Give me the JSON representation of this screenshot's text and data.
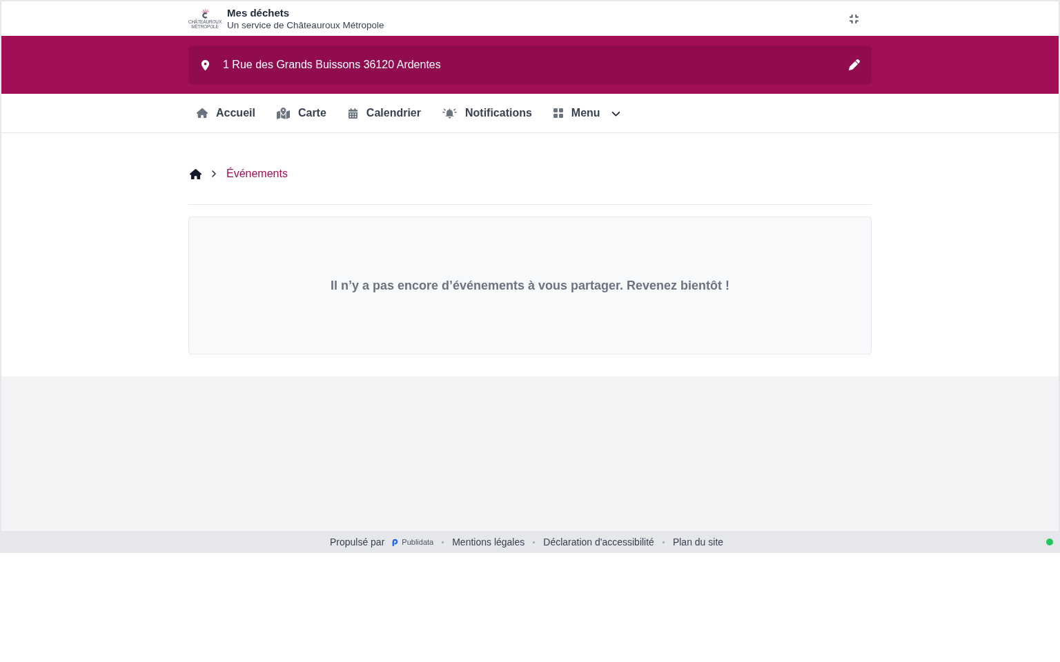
{
  "header": {
    "title": "Mes déchets",
    "subtitle": "Un service de Châteauroux Métropole",
    "logo_lines": [
      "CHÂTEAUROUX",
      "MÉTROPOLE"
    ]
  },
  "address": {
    "text": "1 Rue des Grands Buissons 36120 Ardentes"
  },
  "nav": {
    "links": [
      {
        "label": "Accueil"
      },
      {
        "label": "Carte"
      },
      {
        "label": "Calendrier"
      },
      {
        "label": "Notifications"
      }
    ],
    "menu": {
      "label": "Menu",
      "expanded": false
    }
  },
  "breadcrumb": {
    "current": "Événements"
  },
  "empty_state": {
    "message": "Il n’y a pas encore d’événements à vous partager. Revenez bientôt !"
  },
  "footer": {
    "powered_by": "Propulsé par",
    "brand": "Publidata",
    "links": [
      "Mentions légales",
      "Déclaration d'accessibilité",
      "Plan du site"
    ],
    "status": {
      "color": "#22c55e"
    }
  }
}
